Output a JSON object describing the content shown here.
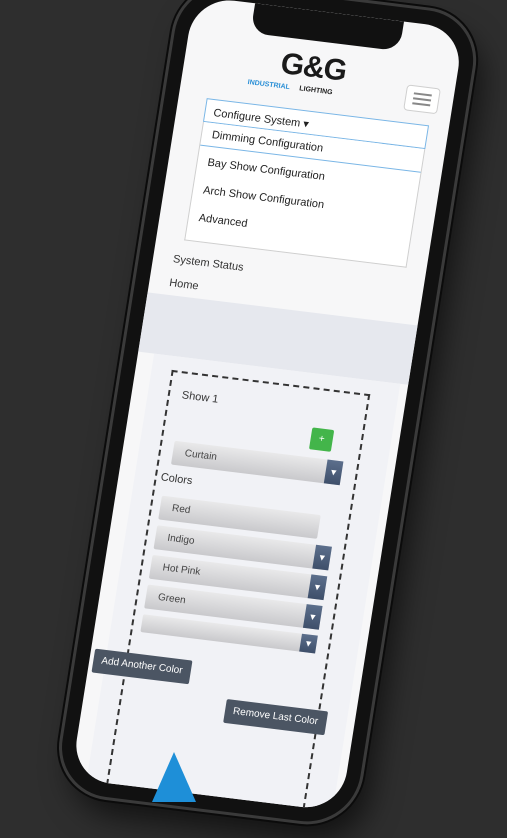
{
  "brand": {
    "logo_main": "G&G",
    "logo_sub_industrial": "INDUSTRIAL",
    "logo_sub_lighting": "LIGHTING"
  },
  "nav": {
    "configure_toggle": "Configure System ▾",
    "menu_items": [
      "Dimming Configuration",
      "Bay Show Configuration",
      "Arch Show Configuration",
      "Advanced"
    ],
    "system_status": "System Status",
    "home": "Home"
  },
  "show_editor": {
    "show_label": "Show 1",
    "add_show_symbol": "+",
    "effect_select": "Curtain",
    "colors_label": "Colors",
    "colors": [
      "Red",
      "Indigo",
      "Hot Pink",
      "Green"
    ],
    "add_color_button": "Add Another Color",
    "remove_color_button": "Remove Last Color"
  },
  "colors": {
    "brand_blue": "#2a8fd6",
    "add_green": "#43b54a",
    "pointer_blue": "#1e8fd8"
  }
}
